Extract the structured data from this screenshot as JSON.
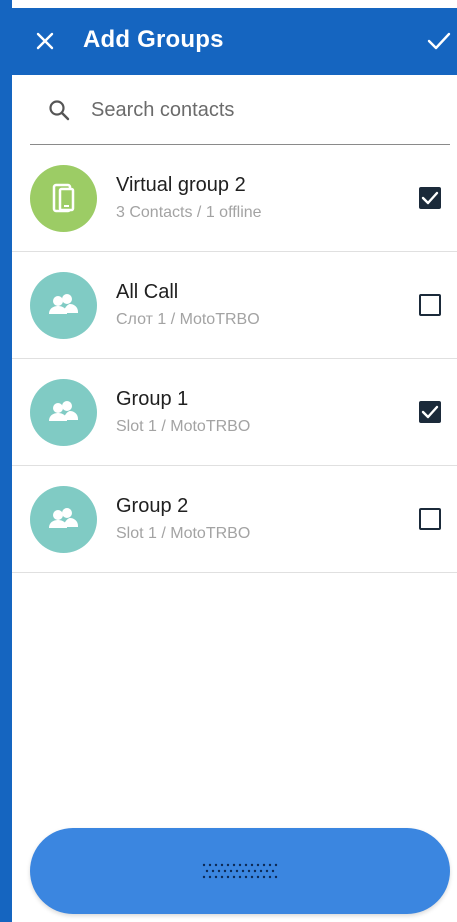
{
  "colors": {
    "header_bg": "#1565c0",
    "virtual_avatar": "#9ccc65",
    "group_avatar": "#80cbc4",
    "checkbox": "#1b2a3a",
    "ptt_button": "#3b86e0"
  },
  "header": {
    "title": "Add Groups",
    "close_icon": "close-icon",
    "confirm_icon": "check-icon"
  },
  "search": {
    "placeholder": "Search contacts",
    "value": "",
    "icon": "search-icon"
  },
  "groups": [
    {
      "name": "Virtual group 2",
      "subtitle": "3 Contacts / 1 offline",
      "avatar_icon": "phone-icon",
      "avatar_color": "#9ccc65",
      "checked": true
    },
    {
      "name": "All Call",
      "subtitle": "Слот 1 / MotoTRBO",
      "avatar_icon": "group-icon",
      "avatar_color": "#80cbc4",
      "checked": false
    },
    {
      "name": "Group 1",
      "subtitle": "Slot 1 / MotoTRBO",
      "avatar_icon": "group-icon",
      "avatar_color": "#80cbc4",
      "checked": true
    },
    {
      "name": "Group 2",
      "subtitle": "Slot 1 / MotoTRBO",
      "avatar_icon": "group-icon",
      "avatar_color": "#80cbc4",
      "checked": false
    }
  ],
  "ptt_button": {
    "icon": "grip-dots-icon"
  }
}
